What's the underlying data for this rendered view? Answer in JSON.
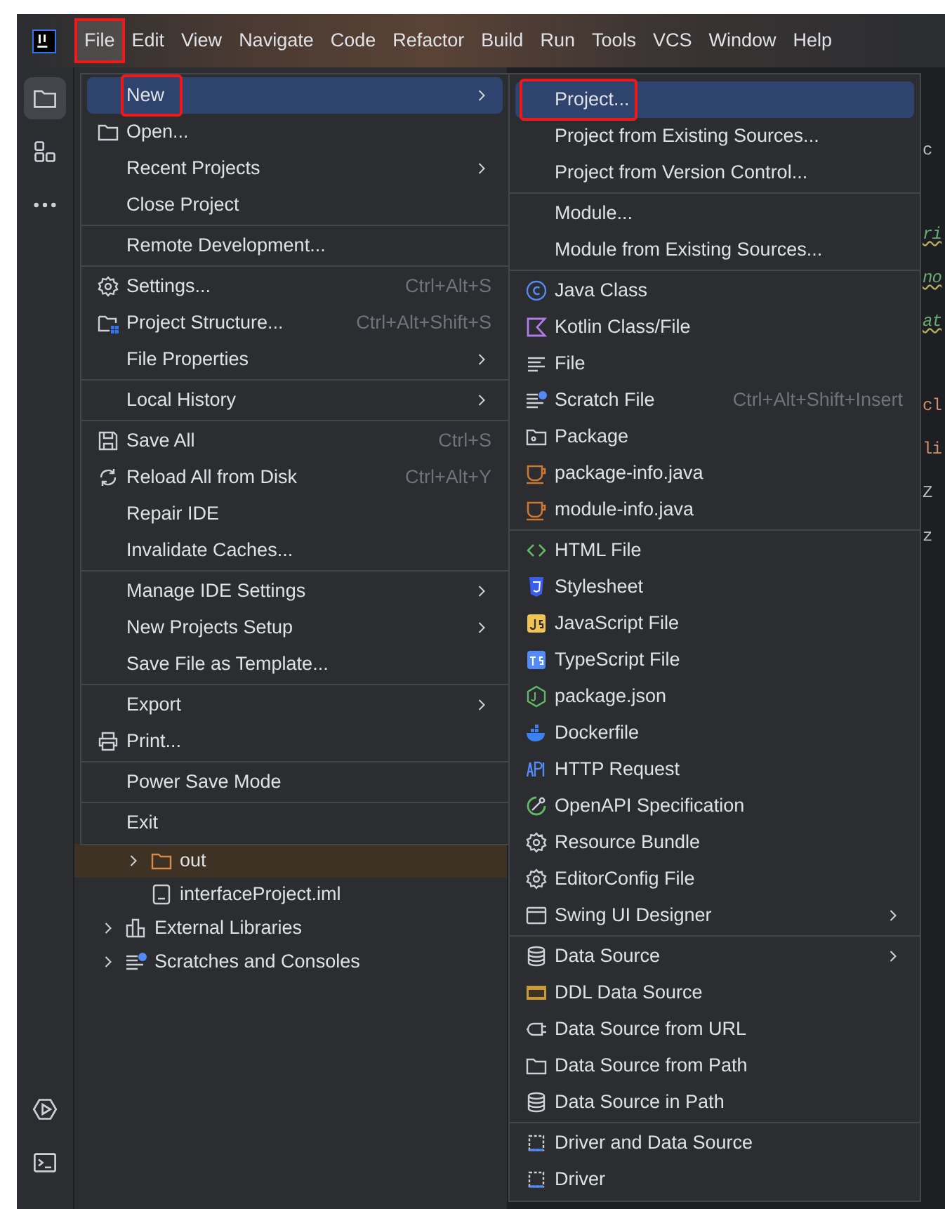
{
  "menu_bar": [
    {
      "label": "File",
      "selected": true,
      "highlighted": true
    },
    {
      "label": "Edit",
      "selected": false
    },
    {
      "label": "View",
      "selected": false
    },
    {
      "label": "Navigate",
      "selected": false
    },
    {
      "label": "Code",
      "selected": false
    },
    {
      "label": "Refactor",
      "selected": false
    },
    {
      "label": "Build",
      "selected": false
    },
    {
      "label": "Run",
      "selected": false
    },
    {
      "label": "Tools",
      "selected": false
    },
    {
      "label": "VCS",
      "selected": false
    },
    {
      "label": "Window",
      "selected": false
    },
    {
      "label": "Help",
      "selected": false
    }
  ],
  "tool_strip": {
    "top": [
      {
        "kind": "folder",
        "selected": true
      },
      {
        "kind": "structure",
        "selected": false
      },
      {
        "kind": "more",
        "selected": false
      }
    ],
    "bottom": [
      {
        "kind": "run",
        "selected": false
      },
      {
        "kind": "terminal",
        "selected": false
      }
    ]
  },
  "editor_blocks": [
    [
      {
        "text": "c",
        "kind": "plain"
      }
    ],
    [
      {
        "text": "ri",
        "kind": "doc"
      },
      {
        "text": "no",
        "kind": "doc"
      },
      {
        "text": "at",
        "kind": "doc"
      }
    ],
    [
      {
        "text": "cl",
        "kind": "keyword"
      },
      {
        "text": "li",
        "kind": "keyword"
      },
      {
        "text": "Z",
        "kind": "plain"
      },
      {
        "text": "z",
        "kind": "plain"
      }
    ]
  ],
  "project_tree": [
    {
      "children": [
        {
          "label": "out",
          "kind": "folder",
          "expanded": false,
          "selected": true
        },
        {
          "label": "interfaceProject.iml",
          "kind": "file",
          "selected": false
        }
      ]
    },
    {
      "label": "External Libraries",
      "kind": "libraries",
      "expanded": false,
      "selected": false
    },
    {
      "label": "Scratches and Consoles",
      "kind": "scratch",
      "expanded": false,
      "selected": false
    }
  ],
  "file_menu": [
    [
      {
        "label": "New",
        "has_submenu": true,
        "selected": true,
        "highlighted": true
      },
      {
        "label": "Open...",
        "kind": "folder",
        "has_submenu": false,
        "selected": false
      },
      {
        "label": "Recent Projects",
        "has_submenu": true,
        "selected": false
      },
      {
        "label": "Close Project",
        "has_submenu": false,
        "selected": false
      }
    ],
    [
      {
        "label": "Remote Development...",
        "has_submenu": false,
        "selected": false
      }
    ],
    [
      {
        "label": "Settings...",
        "kind": "gear",
        "shortcut": "Ctrl+Alt+S",
        "has_submenu": false,
        "selected": false
      },
      {
        "label": "Project Structure...",
        "kind": "project-structure",
        "shortcut": "Ctrl+Alt+Shift+S",
        "has_submenu": false,
        "selected": false
      },
      {
        "label": "File Properties",
        "has_submenu": true,
        "selected": false
      }
    ],
    [
      {
        "label": "Local History",
        "has_submenu": true,
        "selected": false
      }
    ],
    [
      {
        "label": "Save All",
        "kind": "save",
        "shortcut": "Ctrl+S",
        "has_submenu": false,
        "selected": false
      },
      {
        "label": "Reload All from Disk",
        "kind": "reload",
        "shortcut": "Ctrl+Alt+Y",
        "has_submenu": false,
        "selected": false
      },
      {
        "label": "Repair IDE",
        "has_submenu": false,
        "selected": false
      },
      {
        "label": "Invalidate Caches...",
        "has_submenu": false,
        "selected": false
      }
    ],
    [
      {
        "label": "Manage IDE Settings",
        "has_submenu": true,
        "selected": false
      },
      {
        "label": "New Projects Setup",
        "has_submenu": true,
        "selected": false
      },
      {
        "label": "Save File as Template...",
        "has_submenu": false,
        "selected": false
      }
    ],
    [
      {
        "label": "Export",
        "has_submenu": true,
        "selected": false
      },
      {
        "label": "Print...",
        "kind": "print",
        "has_submenu": false,
        "selected": false
      }
    ],
    [
      {
        "label": "Power Save Mode",
        "has_submenu": false,
        "selected": false
      }
    ],
    [
      {
        "label": "Exit",
        "has_submenu": false,
        "selected": false
      }
    ]
  ],
  "new_submenu": [
    [
      {
        "label": "Project...",
        "has_submenu": false,
        "selected": true,
        "highlighted": true
      },
      {
        "label": "Project from Existing Sources...",
        "has_submenu": false,
        "selected": false
      },
      {
        "label": "Project from Version Control...",
        "has_submenu": false,
        "selected": false
      }
    ],
    [
      {
        "label": "Module...",
        "has_submenu": false,
        "selected": false
      },
      {
        "label": "Module from Existing Sources...",
        "has_submenu": false,
        "selected": false
      }
    ],
    [
      {
        "label": "Java Class",
        "kind": "java-class",
        "has_submenu": false,
        "selected": false
      },
      {
        "label": "Kotlin Class/File",
        "kind": "kotlin",
        "has_submenu": false,
        "selected": false
      },
      {
        "label": "File",
        "kind": "lines",
        "has_submenu": false,
        "selected": false
      },
      {
        "label": "Scratch File",
        "kind": "scratch",
        "shortcut": "Ctrl+Alt+Shift+Insert",
        "has_submenu": false,
        "selected": false
      },
      {
        "label": "Package",
        "kind": "package",
        "has_submenu": false,
        "selected": false
      },
      {
        "label": "package-info.java",
        "kind": "cup",
        "has_submenu": false,
        "selected": false
      },
      {
        "label": "module-info.java",
        "kind": "cup",
        "has_submenu": false,
        "selected": false
      }
    ],
    [
      {
        "label": "HTML File",
        "kind": "html",
        "has_submenu": false,
        "selected": false
      },
      {
        "label": "Stylesheet",
        "kind": "css",
        "has_submenu": false,
        "selected": false
      },
      {
        "label": "JavaScript File",
        "kind": "js",
        "has_submenu": false,
        "selected": false
      },
      {
        "label": "TypeScript File",
        "kind": "ts",
        "has_submenu": false,
        "selected": false
      },
      {
        "label": "package.json",
        "kind": "node",
        "has_submenu": false,
        "selected": false
      },
      {
        "label": "Dockerfile",
        "kind": "docker",
        "has_submenu": false,
        "selected": false
      },
      {
        "label": "HTTP Request",
        "kind": "api",
        "has_submenu": false,
        "selected": false
      },
      {
        "label": "OpenAPI Specification",
        "kind": "openapi",
        "has_submenu": false,
        "selected": false
      },
      {
        "label": "Resource Bundle",
        "kind": "gear",
        "has_submenu": false,
        "selected": false
      },
      {
        "label": "EditorConfig File",
        "kind": "gear",
        "has_submenu": false,
        "selected": false
      },
      {
        "label": "Swing UI Designer",
        "kind": "window",
        "has_submenu": true,
        "selected": false
      }
    ],
    [
      {
        "label": "Data Source",
        "kind": "database",
        "has_submenu": true,
        "selected": false
      },
      {
        "label": "DDL Data Source",
        "kind": "ddl",
        "has_submenu": false,
        "selected": false
      },
      {
        "label": "Data Source from URL",
        "kind": "plug",
        "has_submenu": false,
        "selected": false
      },
      {
        "label": "Data Source from Path",
        "kind": "folder",
        "has_submenu": false,
        "selected": false
      },
      {
        "label": "Data Source in Path",
        "kind": "database",
        "has_submenu": false,
        "selected": false
      }
    ],
    [
      {
        "label": "Driver and Data Source",
        "kind": "driver",
        "has_submenu": false,
        "selected": false
      },
      {
        "label": "Driver",
        "kind": "driver",
        "has_submenu": false,
        "selected": false
      }
    ]
  ]
}
